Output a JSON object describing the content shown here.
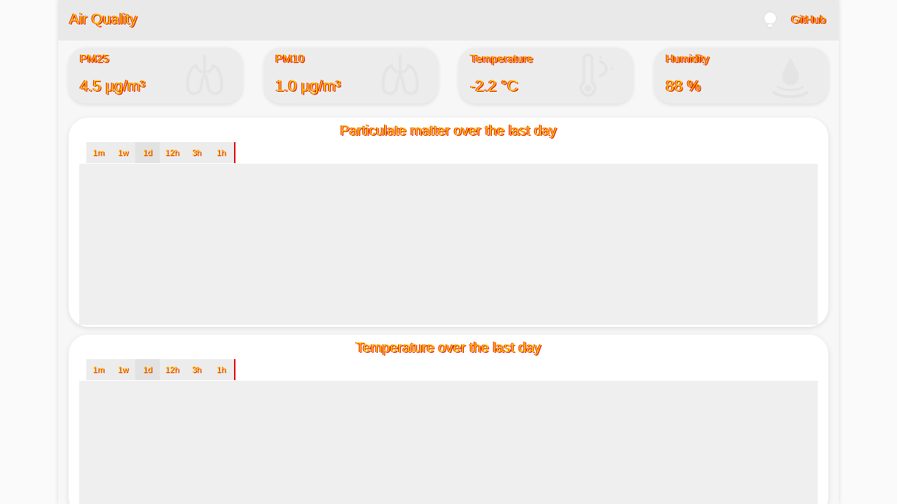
{
  "navbar": {
    "title": "Air Quality",
    "github_label": "GitHub",
    "theme_toggle_icon": "lightbulb-icon"
  },
  "stats": [
    {
      "label": "PM25",
      "value": "4.5 µg/m³",
      "icon": "lungs-icon"
    },
    {
      "label": "PM10",
      "value": "1.0 µg/m³",
      "icon": "lungs-icon"
    },
    {
      "label": "Temperature",
      "value": "-2.2 °C",
      "icon": "thermometer-icon"
    },
    {
      "label": "Humidity",
      "value": "88 %",
      "icon": "water-drop-icon"
    }
  ],
  "charts": [
    {
      "title": "Particulate matter over the last day",
      "ranges": [
        "1m",
        "1w",
        "1d",
        "12h",
        "3h",
        "1h"
      ],
      "active_range": "1d"
    },
    {
      "title": "Temperature over the last day",
      "ranges": [
        "1m",
        "1w",
        "1d",
        "12h",
        "3h",
        "1h"
      ],
      "active_range": "1d"
    }
  ],
  "colors": {
    "text": "#ffd400",
    "text_outline": "#e00000",
    "navbar_bg": "#e9e9e9",
    "card_bg": "#ffffff",
    "plot_bg": "#efefef"
  }
}
